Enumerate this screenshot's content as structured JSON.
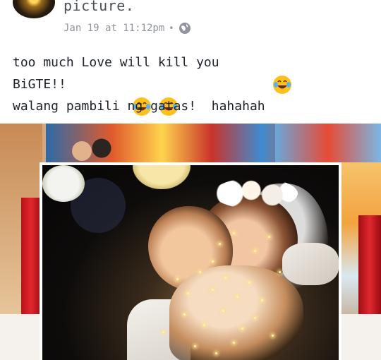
{
  "post": {
    "header_text": "picture.",
    "timestamp": "Jan 19 at 11:12pm",
    "separator": "•",
    "privacy_icon": "globe-icon",
    "body_lines": [
      "too much Love will kill you",
      "BiGTE!!",
      "walang pambili ng gatas!  hahahah"
    ],
    "emoji_icon": "laughing-tears-emoji"
  },
  "colors": {
    "meta_gray": "#90949c",
    "text_dark": "#1d2129",
    "header_gray": "#4b4f56"
  }
}
